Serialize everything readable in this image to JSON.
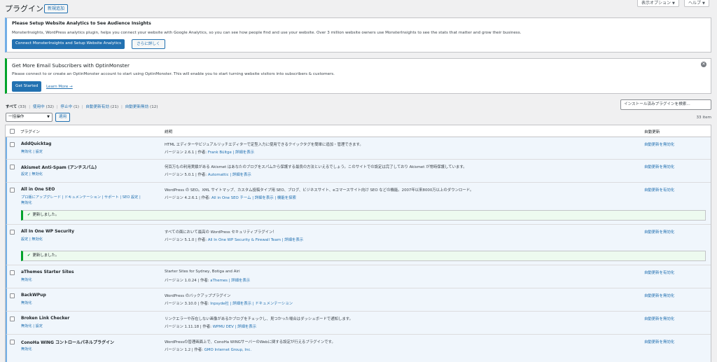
{
  "header": {
    "title": "プラグイン",
    "add_new": "新規追加",
    "screen_options": "表示オプション",
    "help": "ヘルプ"
  },
  "notice1": {
    "title": "Please Setup Website Analytics to See Audience Insights",
    "text": "MonsterInsights, WordPress analytics plugin, helps you connect your website with Google Analytics, so you can see how people find and use your website. Over 3 million website owners use MonsterInsights to see the stats that matter and grow their business.",
    "primary_button": "Connect MonsterInsights and Setup Website Analytics",
    "secondary_button": "さらに詳しく"
  },
  "notice2": {
    "title": "Get More Email Subscribers with OptinMonster",
    "text": "Please connect to or create an OptinMonster account to start using OptinMonster. This will enable you to start turning website visitors into subscribers & customers.",
    "primary_button": "Get Started",
    "link": "Learn More →",
    "dismiss": "✕"
  },
  "filters": {
    "all": "すべて",
    "all_count": "(33)",
    "active": "使用中",
    "active_count": "(32)",
    "inactive": "停止中",
    "inactive_count": "(1)",
    "auto_enabled": "自動更新有効",
    "auto_enabled_count": "(21)",
    "auto_disabled": "自動更新無効",
    "auto_disabled_count": "(12)",
    "sep": "|"
  },
  "search": {
    "placeholder": "インストール済みプラグインを検索..."
  },
  "bulk": {
    "selected": "一括操作",
    "apply": "適用",
    "items": "33 item"
  },
  "table": {
    "col_plugin": "プラグイン",
    "col_desc": "説明",
    "col_auto": "自動更新"
  },
  "rows": [
    {
      "name": "AddQuicktag",
      "actions": "無効化 | 設定",
      "desc": "HTML エディターやビジュアルリッチエディターで定型入力に使用できるクイックタグを簡単に追加・管理できます。",
      "version": "バージョン 2.6.1 | 作者: ",
      "author": "Frank Bültge",
      "details": " | 詳細を表示",
      "auto": "自動更新を無効化"
    },
    {
      "name": "Akismet Anti-Spam (アンチスパム)",
      "actions": "設定 | 無効化",
      "desc": "何百万もの利用実績がある Akismet はあなたのブログをスパムから保護する最良の方法といえるでしょう。このサイトでの設定は完了しており Akismet が常時保護しています。",
      "version": "バージョン 5.0.1 | 作者: ",
      "author": "Automattic",
      "details": " | 詳細を表示",
      "auto": "自動更新を無効化"
    },
    {
      "name": "All in One SEO",
      "actions_line1": "プロ版にアップグレード | ドキュメンテーション | サポート | SEO 設定 |",
      "actions_line2": "無効化",
      "desc": "WordPress の SEO。XML サイトマップ、カスタム投稿タイプ用 SEO、ブログ、ビジネスサイト、eコマースサイト向け SEO などの機能。2007年以来8000万以上のダウンロード。",
      "version": "バージョン 4.2.6.1 | 作者: ",
      "author": "All in One SEO チーム",
      "details": " | 詳細を表示 | 機能を探索",
      "auto": "自動更新を有効化",
      "updated": "更新しました。"
    },
    {
      "name": "All In One WP Security",
      "actions": "設定 | 無効化",
      "desc": "すべての面において最高の WordPress セキュリティプラグイン！",
      "version": "バージョン 5.1.0 | 作者: ",
      "author": "All In One WP Security & Firewall Team",
      "details": " | 詳細を表示",
      "auto": "自動更新を無効化",
      "updated": "更新しました。"
    },
    {
      "name": "aThemes Starter Sites",
      "actions": "無効化",
      "desc": "Starter Sites for Sydney, Botiga and Airi",
      "version": "バージョン 1.0.24 | 作者: ",
      "author": "aThemes",
      "details": " | 詳細を表示",
      "auto": "自動更新を有効化"
    },
    {
      "name": "BackWPup",
      "actions": "無効化",
      "desc": "WordPress のバックアッププラグイン",
      "version": "バージョン 3.10.0 | 作者: ",
      "author": "Inpsyde社",
      "details": " | 詳細を表示 | ドキュメンテーション",
      "auto": "自動更新を無効化"
    },
    {
      "name": "Broken Link Checker",
      "actions": "無効化 | 設定",
      "desc": "リンクエラーや存在しない画像があるかブログをチェックし、見つかった場合はダッシュボードで通知します。",
      "version": "バージョン 1.11.18 | 作者: ",
      "author": "WPMU DEV",
      "details": " | 詳細を表示",
      "auto": "自動更新を無効化"
    },
    {
      "name": "ConoHa WING コントロールパネルプラグイン",
      "actions": "無効化",
      "desc": "WordPressの管理画面上で、ConoHa WINGサーバーのWebに関する設定が行えるプラグインです。",
      "version": "バージョン 1.2 | 作者: ",
      "author": "GMO Internet Group, Inc.",
      "details": "",
      "auto": "自動更新を無効化"
    }
  ],
  "update_check": "✔",
  "dropdown_arrow": "▼"
}
